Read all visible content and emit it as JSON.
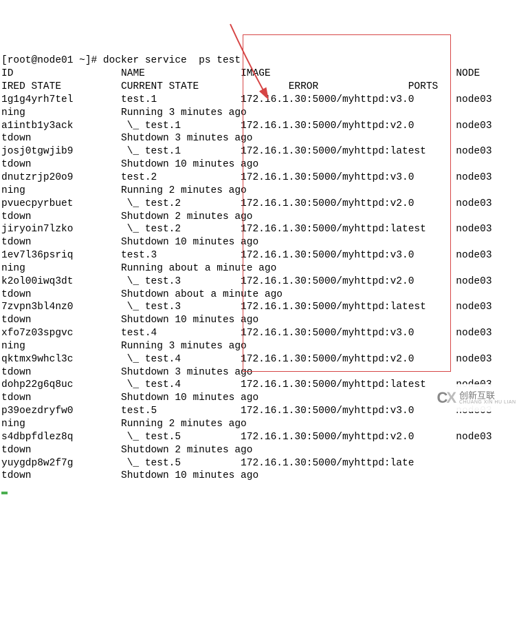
{
  "prompt": "[root@node01 ~]# docker service  ps test",
  "headers": {
    "col1": "ID",
    "col2": "NAME",
    "col3": "IMAGE",
    "col4": "NODE",
    "col5": "IRED STATE",
    "col6": "CURRENT STATE",
    "col7": "ERROR",
    "col8": "PORTS"
  },
  "rows": [
    {
      "id": "1g1g4yrh7tel",
      "name": "test.1",
      "image": "172.16.1.30:5000/myhttpd:v3.0",
      "node": "node03",
      "state": "ning",
      "cur": "Running 3 minutes ago"
    },
    {
      "id": "a1intb1y3ack",
      "name": " \\_ test.1",
      "image": "172.16.1.30:5000/myhttpd:v2.0",
      "node": "node03",
      "state": "tdown",
      "cur": "Shutdown 3 minutes ago"
    },
    {
      "id": "josj0tgwjib9",
      "name": " \\_ test.1",
      "image": "172.16.1.30:5000/myhttpd:latest",
      "node": "node03",
      "state": "tdown",
      "cur": "Shutdown 10 minutes ago"
    },
    {
      "id": "dnutzrjp20o9",
      "name": "test.2",
      "image": "172.16.1.30:5000/myhttpd:v3.0",
      "node": "node03",
      "state": "ning",
      "cur": "Running 2 minutes ago"
    },
    {
      "id": "pvuecpyrbuet",
      "name": " \\_ test.2",
      "image": "172.16.1.30:5000/myhttpd:v2.0",
      "node": "node03",
      "state": "tdown",
      "cur": "Shutdown 2 minutes ago"
    },
    {
      "id": "jiryoin7lzko",
      "name": " \\_ test.2",
      "image": "172.16.1.30:5000/myhttpd:latest",
      "node": "node03",
      "state": "tdown",
      "cur": "Shutdown 10 minutes ago"
    },
    {
      "id": "1ev7l36psriq",
      "name": "test.3",
      "image": "172.16.1.30:5000/myhttpd:v3.0",
      "node": "node03",
      "state": "ning",
      "cur": "Running about a minute ago"
    },
    {
      "id": "k2ol00iwq3dt",
      "name": " \\_ test.3",
      "image": "172.16.1.30:5000/myhttpd:v2.0",
      "node": "node03",
      "state": "tdown",
      "cur": "Shutdown about a minute ago"
    },
    {
      "id": "7zvpn3bl4nz0",
      "name": " \\_ test.3",
      "image": "172.16.1.30:5000/myhttpd:latest",
      "node": "node03",
      "state": "tdown",
      "cur": "Shutdown 10 minutes ago"
    },
    {
      "id": "xfo7z03spgvc",
      "name": "test.4",
      "image": "172.16.1.30:5000/myhttpd:v3.0",
      "node": "node03",
      "state": "ning",
      "cur": "Running 3 minutes ago"
    },
    {
      "id": "qktmx9whcl3c",
      "name": " \\_ test.4",
      "image": "172.16.1.30:5000/myhttpd:v2.0",
      "node": "node03",
      "state": "tdown",
      "cur": "Shutdown 3 minutes ago"
    },
    {
      "id": "dohp22g6q8uc",
      "name": " \\_ test.4",
      "image": "172.16.1.30:5000/myhttpd:latest",
      "node": "node03",
      "state": "tdown",
      "cur": "Shutdown 10 minutes ago"
    },
    {
      "id": "p39oezdryfw0",
      "name": "test.5",
      "image": "172.16.1.30:5000/myhttpd:v3.0",
      "node": "node03",
      "state": "ning",
      "cur": "Running 2 minutes ago"
    },
    {
      "id": "s4dbpfdlez8q",
      "name": " \\_ test.5",
      "image": "172.16.1.30:5000/myhttpd:v2.0",
      "node": "node03",
      "state": "tdown",
      "cur": "Shutdown 2 minutes ago"
    },
    {
      "id": "yuygdp8w2f7g",
      "name": " \\_ test.5",
      "image": "172.16.1.30:5000/myhttpd:late",
      "node": "",
      "state": "tdown",
      "cur": "Shutdown 10 minutes ago"
    }
  ],
  "watermark": {
    "brand": "创新互联",
    "pinyin": "CHUANG XIN HU LIAN"
  },
  "annotation": {
    "box_color": "#d64545",
    "arrow_color": "#d64545"
  }
}
